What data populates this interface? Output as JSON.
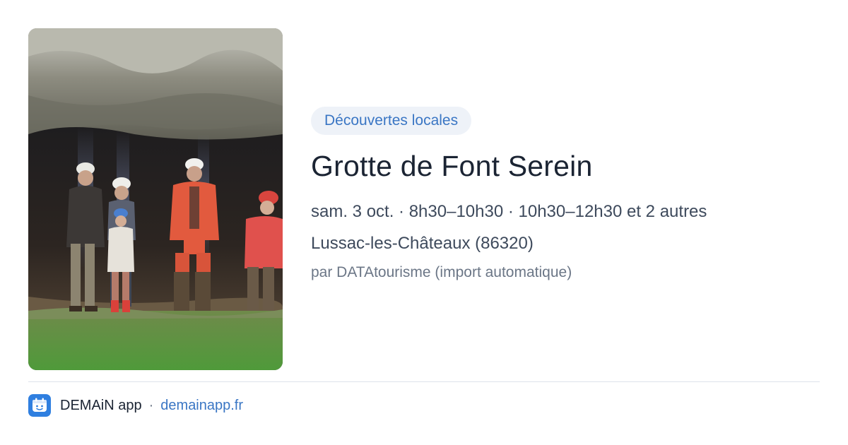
{
  "event": {
    "category": "Découvertes locales",
    "title": "Grotte de Font Serein",
    "schedule": "sam. 3 oct. · 8h30–10h30 · 10h30–12h30 et 2 autres",
    "location": "Lussac-les-Châteaux (86320)",
    "source": "par DATAtourisme (import automatique)",
    "image_alt": "Groupe de spéléologues casqués devant l'entrée d'une grotte"
  },
  "footer": {
    "app_name": "DEMAiN app",
    "separator": "·",
    "link": "demainapp.fr",
    "icon": "app-logo-icon"
  },
  "colors": {
    "tag_bg": "#eef2f8",
    "accent": "#3a76c4",
    "app_icon_bg": "#2f7fe0"
  }
}
